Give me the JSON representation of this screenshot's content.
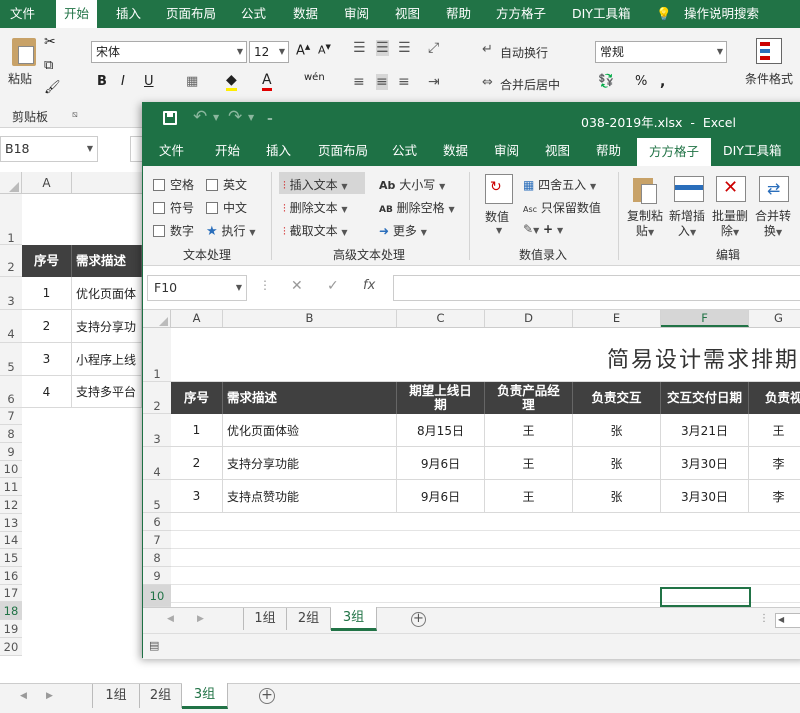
{
  "back_ribbon": {
    "tabs": [
      "文件",
      "开始",
      "插入",
      "页面布局",
      "公式",
      "数据",
      "审阅",
      "视图",
      "帮助",
      "方方格子",
      "DIY工具箱",
      "操作说明搜索"
    ],
    "paste_label": "粘贴",
    "clipboard_label": "剪贴板",
    "font_name": "宋体",
    "font_size": "12",
    "wrap_label": "自动换行",
    "merge_label": "合并后居中",
    "number_format": "常规",
    "cond_format": "条件格式",
    "bold": "B",
    "italic": "I",
    "underline": "U"
  },
  "back_sheet": {
    "name_box": "B18",
    "col_a": "A",
    "row_numbers": [
      "1",
      "2",
      "3",
      "4",
      "5",
      "6",
      "7",
      "8",
      "9",
      "10",
      "11",
      "12",
      "13",
      "14",
      "15",
      "16",
      "17",
      "18",
      "19",
      "20"
    ],
    "header": [
      "序号",
      "需求描述"
    ],
    "rows": [
      [
        "1",
        "优化页面体"
      ],
      [
        "2",
        "支持分享功"
      ],
      [
        "3",
        "小程序上线"
      ],
      [
        "4",
        "支持多平台"
      ]
    ],
    "sheet_tabs": [
      "1组",
      "2组",
      "3组"
    ],
    "active_tab": "3组"
  },
  "front": {
    "title": "038-2019年.xlsx  -  Excel",
    "tabs": [
      "文件",
      "开始",
      "插入",
      "页面布局",
      "公式",
      "数据",
      "审阅",
      "视图",
      "帮助",
      "方方格子",
      "DIY工具箱"
    ],
    "active_tab": "3组",
    "ribbon": {
      "checks": [
        "空格",
        "英文",
        "符号",
        "中文",
        "数字"
      ],
      "exec_label": "执行",
      "text_group": "文本处理",
      "insert_text": "插入文本",
      "delete_text": "删除文本",
      "extract_text": "截取文本",
      "case_label": "大小写",
      "del_space": "删除空格",
      "more_label": "更多",
      "adv_group": "高级文本处理",
      "value_label": "数值",
      "round_label": "四舍五入",
      "keep_value": "只保留数值",
      "num_group": "数值录入",
      "copy_paste": [
        "复制粘",
        "贴"
      ],
      "add_insert": [
        "新增插",
        "入"
      ],
      "batch_delete": [
        "批量删",
        "除"
      ],
      "merge_convert": [
        "合并转",
        "换"
      ],
      "edit_group": "编辑",
      "ab_icon": "Ab",
      "asc_icon": "Asc",
      "ab2_icon": "AB"
    },
    "name_box": "F10",
    "formula_fx": "fx",
    "columns": [
      "A",
      "B",
      "C",
      "D",
      "E",
      "F",
      "G"
    ],
    "sheet_title": "简易设计需求排期表",
    "header": [
      "序号",
      "需求描述",
      "期望上线日期",
      "负责产品经理",
      "负责交互",
      "交互交付日期",
      "负责视"
    ],
    "rows": [
      [
        "1",
        "优化页面体验",
        "8月15日",
        "王",
        "张",
        "3月21日",
        "王"
      ],
      [
        "2",
        "支持分享功能",
        "9月6日",
        "王",
        "张",
        "3月30日",
        "李"
      ],
      [
        "3",
        "支持点赞功能",
        "9月6日",
        "王",
        "张",
        "3月30日",
        "李"
      ]
    ],
    "row_numbers": [
      "1",
      "2",
      "3",
      "4",
      "5",
      "6",
      "7",
      "8",
      "9",
      "10"
    ],
    "sheet_tabs": [
      "1组",
      "2组",
      "3组"
    ]
  },
  "colors": {
    "excel_green": "#217346",
    "title_green": "#1e7145",
    "header_dark": "#404040"
  }
}
